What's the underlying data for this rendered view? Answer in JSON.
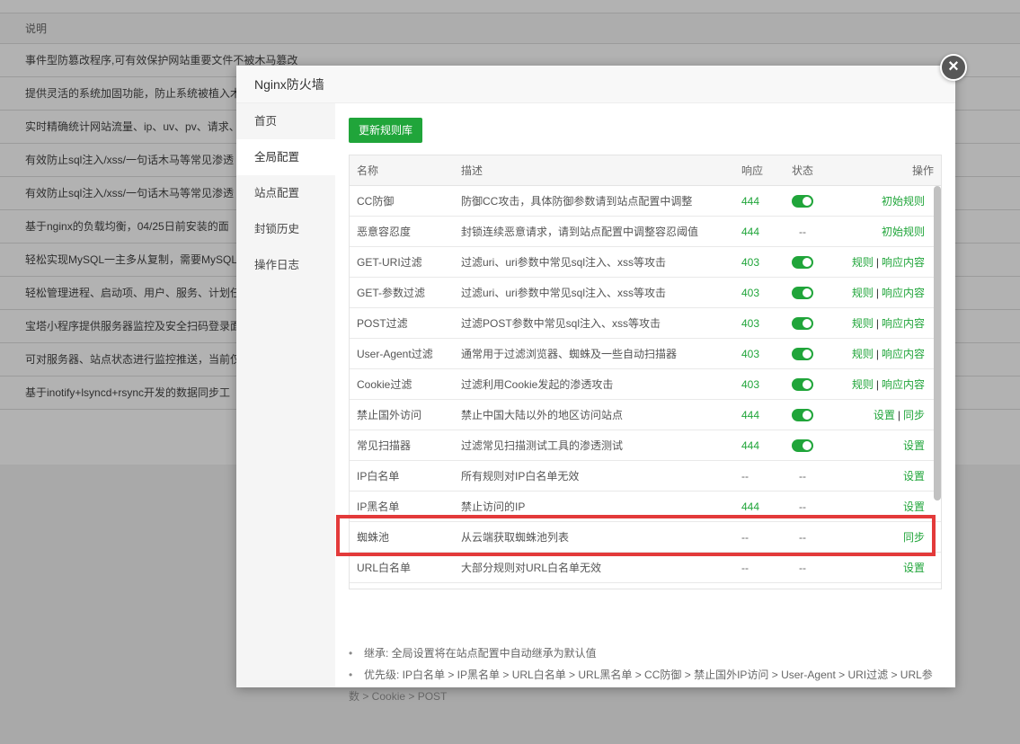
{
  "background": {
    "header": "说明",
    "rows": [
      "事件型防篡改程序,可有效保护网站重要文件不被木马篡改",
      "提供灵活的系统加固功能，防止系统被植入木马",
      "实时精确统计网站流量、ip、uv、pv、请求、",
      "有效防止sql注入/xss/一句话木马等常见渗透",
      "有效防止sql注入/xss/一句话木马等常见渗透",
      "基于nginx的负载均衡，04/25日前安装的面",
      "轻松实现MySQL一主多从复制，需要MySQL",
      "轻松管理进程、启动项、用户、服务、计划任",
      "宝塔小程序提供服务器监控及安全扫码登录面",
      "可对服务器、站点状态进行监控推送，当前仅",
      "基于inotify+lsyncd+rsync开发的数据同步工"
    ]
  },
  "modal": {
    "title": "Nginx防火墙",
    "close_symbol": "×",
    "sidebar": [
      {
        "label": "首页"
      },
      {
        "label": "全局配置"
      },
      {
        "label": "站点配置"
      },
      {
        "label": "封锁历史"
      },
      {
        "label": "操作日志"
      }
    ],
    "update_button": "更新规则库",
    "table": {
      "headers": {
        "name": "名称",
        "desc": "描述",
        "resp": "响应",
        "status": "状态",
        "ops": "操作"
      },
      "rows": [
        {
          "name": "CC防御",
          "desc": "防御CC攻击，具体防御参数请到站点配置中调整",
          "resp": "444",
          "status": "on",
          "ops": [
            "初始规则"
          ]
        },
        {
          "name": "恶意容忍度",
          "desc": "封锁连续恶意请求，请到站点配置中调整容忍阈值",
          "resp": "444",
          "status": "--",
          "ops": [
            "初始规则"
          ]
        },
        {
          "name": "GET-URI过滤",
          "desc": "过滤uri、uri参数中常见sql注入、xss等攻击",
          "resp": "403",
          "status": "on",
          "ops": [
            "规则",
            "响应内容"
          ]
        },
        {
          "name": "GET-参数过滤",
          "desc": "过滤uri、uri参数中常见sql注入、xss等攻击",
          "resp": "403",
          "status": "on",
          "ops": [
            "规则",
            "响应内容"
          ]
        },
        {
          "name": "POST过滤",
          "desc": "过滤POST参数中常见sql注入、xss等攻击",
          "resp": "403",
          "status": "on",
          "ops": [
            "规则",
            "响应内容"
          ]
        },
        {
          "name": "User-Agent过滤",
          "desc": "通常用于过滤浏览器、蜘蛛及一些自动扫描器",
          "resp": "403",
          "status": "on",
          "ops": [
            "规则",
            "响应内容"
          ]
        },
        {
          "name": "Cookie过滤",
          "desc": "过滤利用Cookie发起的渗透攻击",
          "resp": "403",
          "status": "on",
          "ops": [
            "规则",
            "响应内容"
          ]
        },
        {
          "name": "禁止国外访问",
          "desc": "禁止中国大陆以外的地区访问站点",
          "resp": "444",
          "status": "on",
          "ops": [
            "设置",
            "同步"
          ]
        },
        {
          "name": "常见扫描器",
          "desc": "过滤常见扫描测试工具的渗透测试",
          "resp": "444",
          "status": "on",
          "ops": [
            "设置"
          ]
        },
        {
          "name": "IP白名单",
          "desc": "所有规则对IP白名单无效",
          "resp": "--",
          "status": "--",
          "ops": [
            "设置"
          ]
        },
        {
          "name": "IP黑名单",
          "desc": "禁止访问的IP",
          "resp": "444",
          "status": "--",
          "ops": [
            "设置"
          ]
        },
        {
          "name": "蜘蛛池",
          "desc": "从云端获取蜘蛛池列表",
          "resp": "--",
          "status": "--",
          "ops": [
            "同步"
          ]
        },
        {
          "name": "URL白名单",
          "desc": "大部分规则对URL白名单无效",
          "resp": "--",
          "status": "--",
          "ops": [
            "设置"
          ]
        }
      ]
    },
    "notes": [
      "继承: 全局设置将在站点配置中自动继承为默认值",
      "优先级: IP白名单 > IP黑名单 > URL白名单 > URL黑名单 > CC防御 > 禁止国外IP访问 > User-Agent > URI过滤 > URL参数 > Cookie > POST"
    ],
    "colors": {
      "accent": "#20a53a",
      "highlight": "#e33a3a"
    }
  }
}
